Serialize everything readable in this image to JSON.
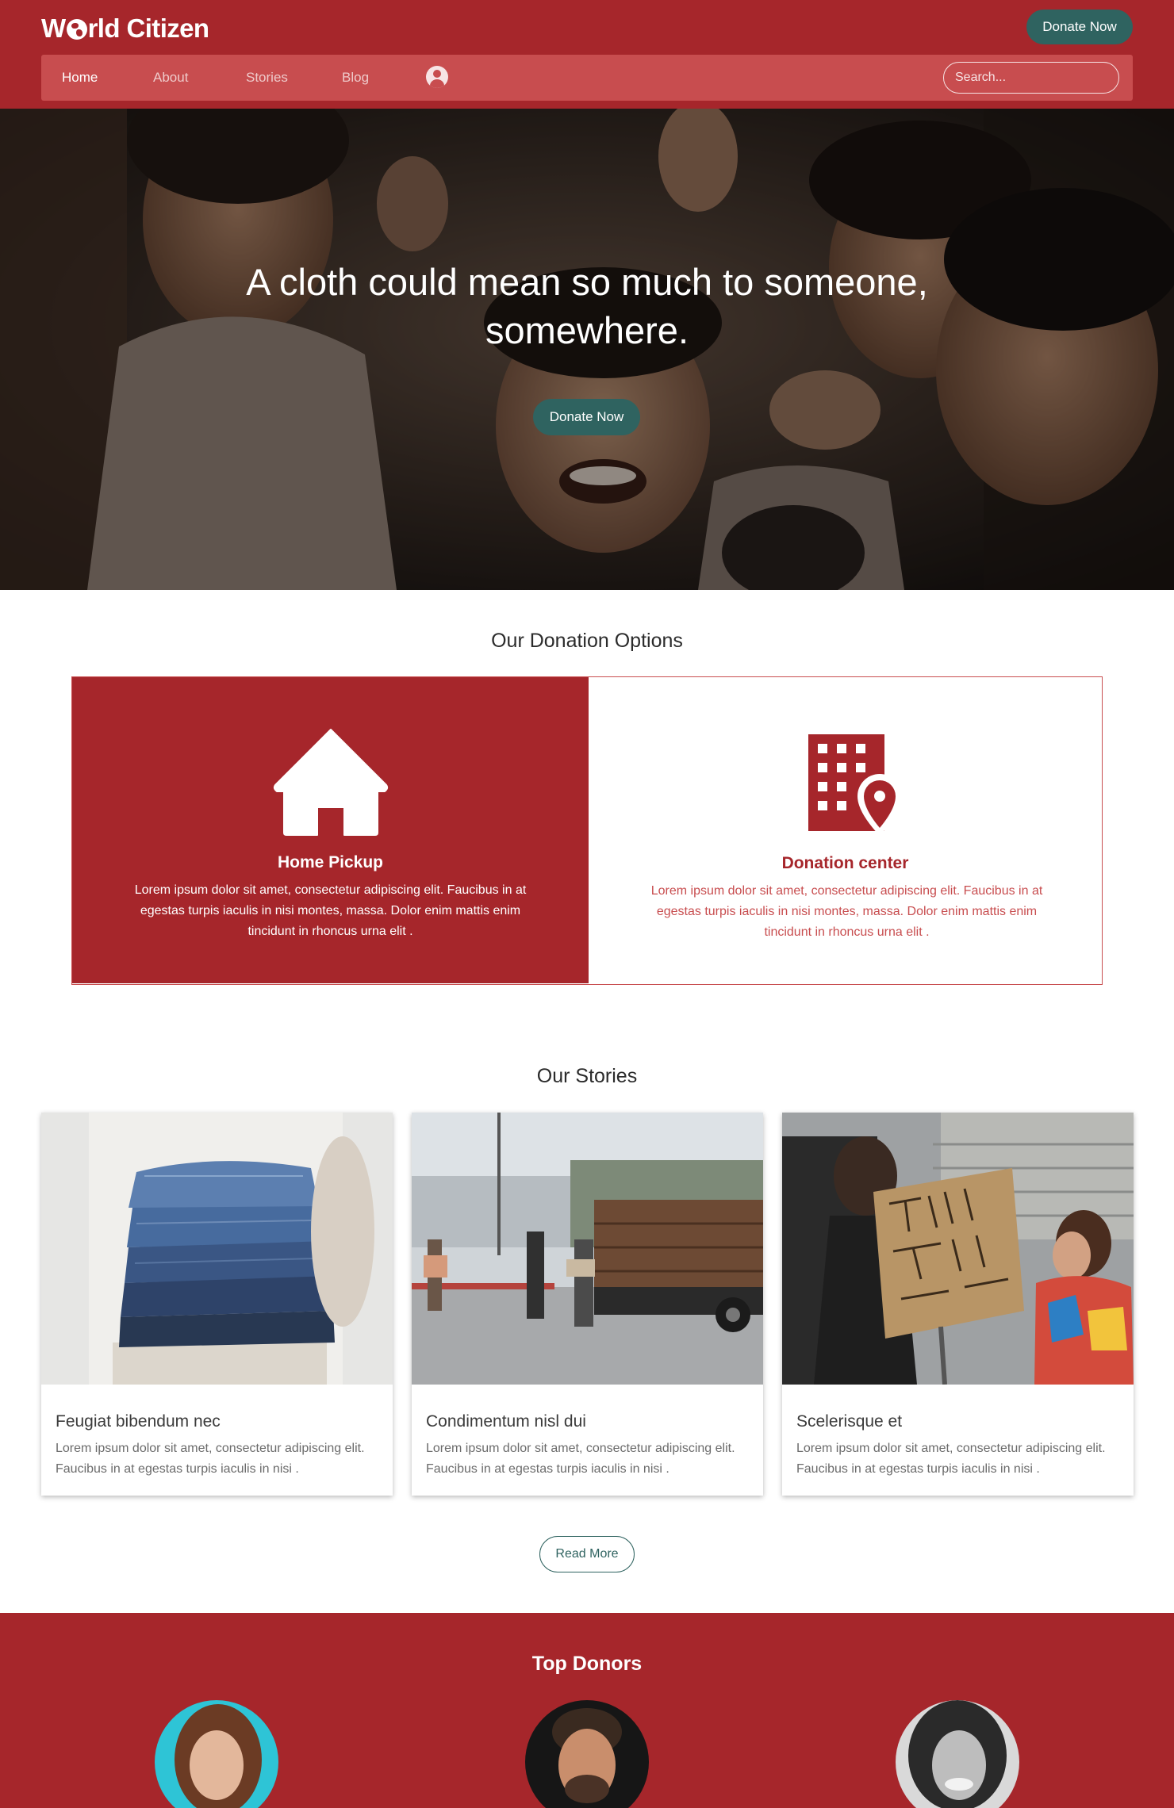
{
  "header": {
    "logo_text": "World Citizen",
    "donate_label": "Donate Now",
    "nav": [
      {
        "label": "Home",
        "active": true
      },
      {
        "label": "About"
      },
      {
        "label": "Stories"
      },
      {
        "label": "Blog"
      }
    ],
    "user_icon": "user-circle-icon",
    "search_placeholder": "Search..."
  },
  "hero": {
    "title": "A cloth could mean so much to someone, somewhere.",
    "button_label": "Donate Now"
  },
  "donation": {
    "section_title": "Our Donation Options",
    "options": [
      {
        "icon": "home-icon",
        "title": "Home Pickup",
        "text": "Lorem ipsum dolor sit amet, consectetur adipiscing elit. Faucibus in at egestas turpis iaculis in nisi montes, massa. Dolor enim mattis enim tincidunt in rhoncus urna elit ."
      },
      {
        "icon": "building-location-icon",
        "title": "Donation center",
        "text": "Lorem ipsum dolor sit amet, consectetur adipiscing elit. Faucibus in at egestas turpis iaculis in nisi montes, massa. Dolor enim mattis enim tincidunt in rhoncus urna elit ."
      }
    ]
  },
  "stories": {
    "section_title": "Our Stories",
    "items": [
      {
        "title": "Feugiat bibendum nec",
        "text": "Lorem ipsum dolor sit amet, consectetur adipiscing elit. Faucibus in at egestas turpis iaculis in nisi ."
      },
      {
        "title": "Condimentum nisl dui",
        "text": "Lorem ipsum dolor sit amet, consectetur adipiscing elit. Faucibus in at egestas turpis iaculis in nisi ."
      },
      {
        "title": "Scelerisque et",
        "text": "Lorem ipsum dolor sit amet, consectetur adipiscing elit. Faucibus in at egestas turpis iaculis in nisi ."
      }
    ],
    "read_more_label": "Read More"
  },
  "donors": {
    "section_title": "Top Donors"
  },
  "colors": {
    "brand_red": "#a6262b",
    "nav_red": "#c84d4f",
    "teal": "#2f6360",
    "white": "#ffffff"
  }
}
